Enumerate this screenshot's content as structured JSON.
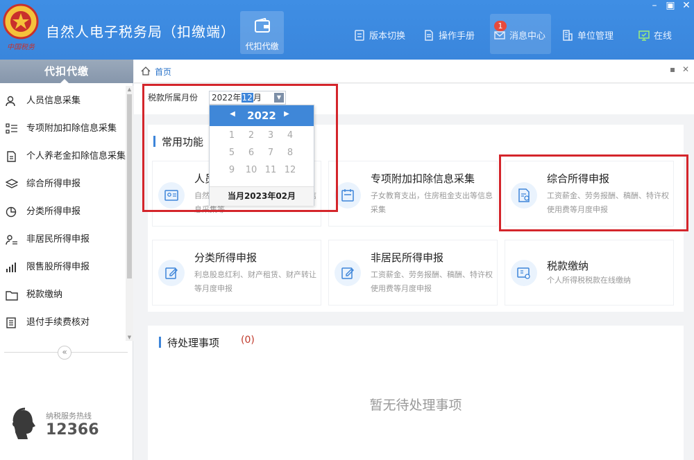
{
  "header": {
    "title": "自然人电子税务局（扣缴端）",
    "logo_text": "中国税务",
    "active_tab": "代扣代缴",
    "buttons": {
      "version": "版本切换",
      "manual": "操作手册",
      "messages": "消息中心",
      "units": "单位管理",
      "online": "在线"
    },
    "message_count": "1"
  },
  "sidebar": {
    "title": "代扣代缴",
    "items": [
      {
        "label": "人员信息采集",
        "icon": "person-icon"
      },
      {
        "label": "专项附加扣除信息采集",
        "icon": "list-icon"
      },
      {
        "label": "个人养老金扣除信息采集",
        "icon": "document-icon"
      },
      {
        "label": "综合所得申报",
        "icon": "layers-icon"
      },
      {
        "label": "分类所得申报",
        "icon": "pie-icon"
      },
      {
        "label": "非居民所得申报",
        "icon": "person-list-icon"
      },
      {
        "label": "限售股所得申报",
        "icon": "bar-chart-icon"
      },
      {
        "label": "税款缴纳",
        "icon": "folder-icon"
      },
      {
        "label": "退付手续费核对",
        "icon": "checklist-icon"
      }
    ],
    "hotline_label": "纳税服务热线",
    "hotline_number": "12366"
  },
  "breadcrumb": {
    "home": "首页"
  },
  "filter": {
    "label": "税款所属月份",
    "value_prefix": "2022年",
    "value_selected": "12",
    "value_suffix": "月"
  },
  "datepicker": {
    "year": "2022",
    "months": [
      "1",
      "2",
      "3",
      "4",
      "5",
      "6",
      "7",
      "8",
      "9",
      "10",
      "11",
      "12"
    ],
    "current_month_button": "当月2023年02月"
  },
  "common_functions": {
    "title": "常用功能",
    "cards": [
      {
        "title": "人员信息采集",
        "desc": "自然人身份信息采集，纳税人基础信息采集等"
      },
      {
        "title": "专项附加扣除信息采集",
        "desc": "子女教育支出，住房租金支出等信息采集"
      },
      {
        "title": "综合所得申报",
        "desc": "工资薪金、劳务报酬、稿酬、特许权使用费等月度申报"
      },
      {
        "title": "分类所得申报",
        "desc": "利息股息红利、财产租赁、财产转让等月度申报"
      },
      {
        "title": "非居民所得申报",
        "desc": "工资薪金、劳务报酬、稿酬、特许权使用费等月度申报"
      },
      {
        "title": "税款缴纳",
        "desc": "个人所得税税款在线缴纳"
      }
    ]
  },
  "pending": {
    "title": "待处理事项",
    "count": "(0)",
    "empty_text": "暂无待处理事项"
  },
  "colors": {
    "header_blue": "#3a86dc",
    "annotation_red": "#d4252b",
    "accent_blue": "#3d85d9"
  }
}
